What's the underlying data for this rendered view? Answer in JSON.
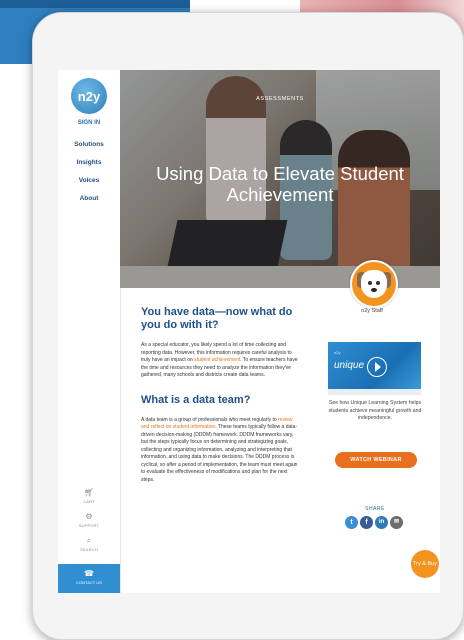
{
  "sidebar": {
    "sign_in": "SIGN IN",
    "nav": [
      "Solutions",
      "Insights",
      "Voices",
      "About"
    ],
    "utilities": [
      {
        "icon": "cart-icon",
        "label": "CART"
      },
      {
        "icon": "support-icon",
        "label": "SUPPORT"
      },
      {
        "icon": "search-icon",
        "label": "SEARCH"
      }
    ],
    "contact": {
      "icon": "headset-icon",
      "label": "CONTACT US"
    }
  },
  "hero": {
    "category": "ASSESSMENTS",
    "title": "Using Data to Elevate Student Achievement"
  },
  "author": {
    "name": "n2y Staff"
  },
  "article": {
    "h1": "You have data—now what do you do with it?",
    "p1_a": "As a special educator, you likely spend a lot of time collecting and reporting data. However, this information requires careful analysis to truly have an impact on ",
    "p1_link": "student achievement",
    "p1_b": ". To ensure teachers have the time and resources they need to analyze the information they've gathered, many schools and districts create data teams.",
    "h2": "What is a data team?",
    "p2_a": "A data team is a group of professionals who meet regularly to ",
    "p2_link": "review and reflect on student information",
    "p2_b": ". These teams typically follow a data-driven decision-making (DDDM) framework. DDDM frameworks vary, but the steps typically focus on determining and strategizing goals, collecting and organizing information, analyzing and interpreting that information, and using data to make decisions. The DDDM process is cyclical, so after a period of implementation, the team must meet again to evaluate the effectiveness of modifications and plan for the next steps."
  },
  "promo": {
    "video_small": "n2y",
    "video_brand": "unique",
    "caption": "See how Unique Learning System helps students achieve meaningful growth and independence.",
    "button": "WATCH WEBINAR"
  },
  "share": {
    "label": "SHARE",
    "icons": [
      "twitter-icon",
      "facebook-icon",
      "linkedin-icon",
      "email-icon"
    ]
  },
  "try_buy": "Try & Buy",
  "colors": {
    "brand_blue": "#1f4f8e",
    "accent_orange": "#e8701d",
    "contact_blue": "#2f8fd0"
  }
}
